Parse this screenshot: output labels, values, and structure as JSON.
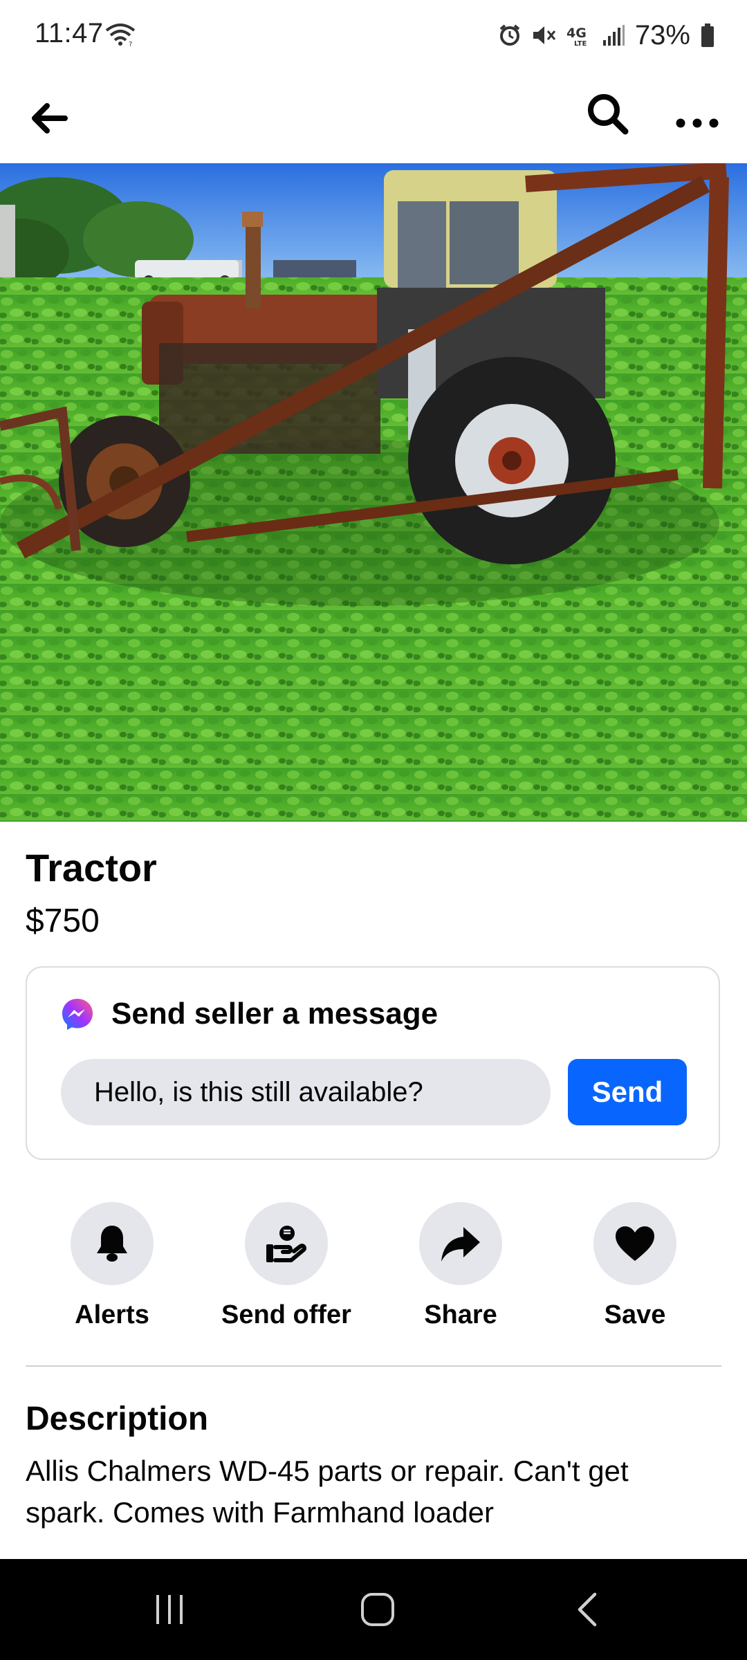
{
  "status_bar": {
    "time": "11:47",
    "battery_percent": "73%",
    "icons": [
      "wifi-icon",
      "alarm-icon",
      "mute-icon",
      "4g-lte-icon",
      "signal-icon",
      "battery-icon"
    ],
    "battery_level": 0.73
  },
  "app_bar": {
    "icons": [
      "back-arrow-icon",
      "search-icon",
      "more-icon"
    ]
  },
  "listing": {
    "title": "Tractor",
    "price": "$750",
    "photo_icon": "tractor-photo"
  },
  "message_card": {
    "header": "Send seller a message",
    "input_value": "Hello, is this still available?",
    "send_label": "Send",
    "icon": "messenger-icon"
  },
  "actions": [
    {
      "label": "Alerts",
      "icon": "bell-icon"
    },
    {
      "label": "Send offer",
      "icon": "offer-hand-icon"
    },
    {
      "label": "Share",
      "icon": "share-arrow-icon"
    },
    {
      "label": "Save",
      "icon": "heart-icon"
    }
  ],
  "description": {
    "heading": "Description",
    "text": "Allis Chalmers WD-45 parts or repair. Can't get spark.  Comes with Farmhand loader"
  },
  "nav_bar": {
    "icons": [
      "recents-icon",
      "home-icon",
      "back-icon"
    ]
  },
  "colors": {
    "accent": "#0866ff",
    "chip": "#e4e6eb",
    "text": "#050505",
    "border": "#dadde1"
  }
}
